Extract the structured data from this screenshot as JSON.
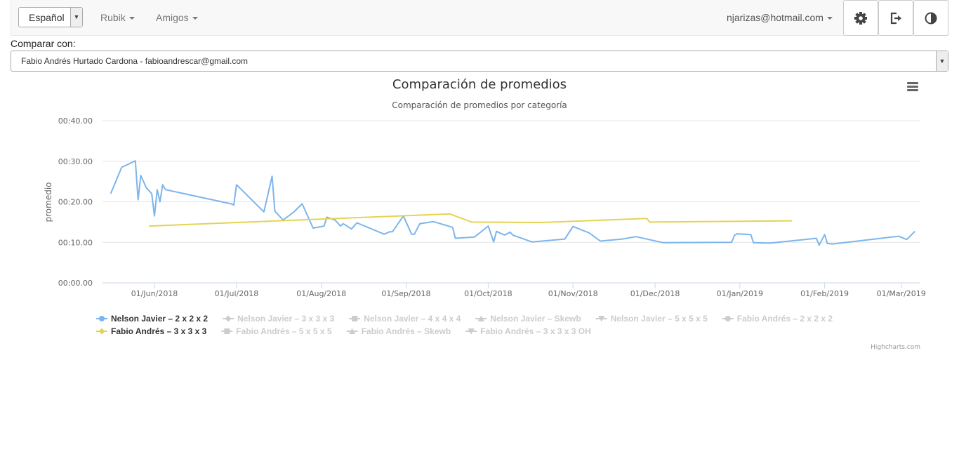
{
  "navbar": {
    "language": "Español",
    "menus": [
      "Rubik",
      "Amigos"
    ],
    "user": "njarizas@hotmail.com",
    "icons": [
      "gear-icon",
      "logout-icon",
      "contrast-icon"
    ]
  },
  "compare": {
    "label": "Comparar con:",
    "selected": "Fabio Andrés Hurtado Cardona - fabioandrescar@gmail.com"
  },
  "chart_data": {
    "type": "line",
    "title": "Comparación de promedios",
    "subtitle": "Comparación de promedios por categoría",
    "ylabel": "promedio",
    "xlabel": "",
    "ylim": [
      0,
      40
    ],
    "yticks": [
      "00:00.00",
      "00:10.00",
      "00:20.00",
      "00:30.00",
      "00:40.00"
    ],
    "xlim": [
      "2018-05-13",
      "2019-03-08"
    ],
    "xticks": [
      {
        "date": "2018-06-01",
        "label": "01/Jun/2018"
      },
      {
        "date": "2018-07-01",
        "label": "01/Jul/2018"
      },
      {
        "date": "2018-08-01",
        "label": "01/Aug/2018"
      },
      {
        "date": "2018-09-01",
        "label": "01/Sep/2018"
      },
      {
        "date": "2018-10-01",
        "label": "01/Oct/2018"
      },
      {
        "date": "2018-11-01",
        "label": "01/Nov/2018"
      },
      {
        "date": "2018-12-01",
        "label": "01/Dec/2018"
      },
      {
        "date": "2019-01-01",
        "label": "01/Jan/2019"
      },
      {
        "date": "2019-02-01",
        "label": "01/Feb/2019"
      },
      {
        "date": "2019-03-01",
        "label": "01/Mar/2019"
      }
    ],
    "grid": true,
    "legend_position": "bottom",
    "legend": [
      {
        "name": "Nelson Javier – 2 x 2 x 2",
        "active": true,
        "color": "#7cb5ec",
        "marker": "circle"
      },
      {
        "name": "Nelson Javier – 3 x 3 x 3",
        "active": false,
        "color": "#cccccc",
        "marker": "diamond"
      },
      {
        "name": "Nelson Javier – 4 x 4 x 4",
        "active": false,
        "color": "#cccccc",
        "marker": "square"
      },
      {
        "name": "Nelson Javier – Skewb",
        "active": false,
        "color": "#cccccc",
        "marker": "triangle"
      },
      {
        "name": "Nelson Javier – 5 x 5 x 5",
        "active": false,
        "color": "#cccccc",
        "marker": "triangle-down"
      },
      {
        "name": "Fabio Andrés – 2 x 2 x 2",
        "active": false,
        "color": "#cccccc",
        "marker": "circle"
      },
      {
        "name": "Fabio Andrés – 3 x 3 x 3",
        "active": true,
        "color": "#e4d354",
        "marker": "diamond"
      },
      {
        "name": "Fabio Andrés – 5 x 5 x 5",
        "active": false,
        "color": "#cccccc",
        "marker": "square"
      },
      {
        "name": "Fabio Andrés – Skewb",
        "active": false,
        "color": "#cccccc",
        "marker": "triangle"
      },
      {
        "name": "Fabio Andrés – 3 x 3 x 3 OH",
        "active": false,
        "color": "#cccccc",
        "marker": "triangle-down"
      }
    ],
    "series": [
      {
        "name": "Nelson Javier – 2 x 2 x 2",
        "color": "#7cb5ec",
        "points": [
          [
            "2018-05-16",
            22.0
          ],
          [
            "2018-05-20",
            28.5
          ],
          [
            "2018-05-25",
            30.1
          ],
          [
            "2018-05-26",
            20.5
          ],
          [
            "2018-05-27",
            26.5
          ],
          [
            "2018-05-29",
            23.5
          ],
          [
            "2018-05-31",
            22.0
          ],
          [
            "2018-06-01",
            16.5
          ],
          [
            "2018-06-02",
            23.0
          ],
          [
            "2018-06-03",
            20.0
          ],
          [
            "2018-06-04",
            24.2
          ],
          [
            "2018-06-05",
            23.0
          ],
          [
            "2018-06-29",
            19.5
          ],
          [
            "2018-06-30",
            19.2
          ],
          [
            "2018-07-01",
            24.2
          ],
          [
            "2018-07-11",
            17.5
          ],
          [
            "2018-07-14",
            26.3
          ],
          [
            "2018-07-15",
            17.7
          ],
          [
            "2018-07-18",
            15.5
          ],
          [
            "2018-07-22",
            17.5
          ],
          [
            "2018-07-25",
            19.5
          ],
          [
            "2018-07-29",
            13.5
          ],
          [
            "2018-08-02",
            14.0
          ],
          [
            "2018-08-03",
            16.2
          ],
          [
            "2018-08-06",
            15.5
          ],
          [
            "2018-08-08",
            14.0
          ],
          [
            "2018-08-09",
            14.6
          ],
          [
            "2018-08-12",
            13.3
          ],
          [
            "2018-08-14",
            14.8
          ],
          [
            "2018-08-24",
            12.0
          ],
          [
            "2018-08-26",
            12.6
          ],
          [
            "2018-08-27",
            12.6
          ],
          [
            "2018-08-31",
            16.5
          ],
          [
            "2018-09-03",
            12.0
          ],
          [
            "2018-09-04",
            12.0
          ],
          [
            "2018-09-06",
            14.6
          ],
          [
            "2018-09-11",
            15.1
          ],
          [
            "2018-09-18",
            13.7
          ],
          [
            "2018-09-19",
            11.0
          ],
          [
            "2018-09-26",
            11.3
          ],
          [
            "2018-10-01",
            14.0
          ],
          [
            "2018-10-03",
            10.1
          ],
          [
            "2018-10-04",
            12.7
          ],
          [
            "2018-10-07",
            11.8
          ],
          [
            "2018-10-09",
            12.5
          ],
          [
            "2018-10-10",
            11.8
          ],
          [
            "2018-10-17",
            10.1
          ],
          [
            "2018-10-29",
            10.8
          ],
          [
            "2018-11-01",
            13.9
          ],
          [
            "2018-11-07",
            12.3
          ],
          [
            "2018-11-11",
            10.3
          ],
          [
            "2018-11-19",
            10.8
          ],
          [
            "2018-11-24",
            11.4
          ],
          [
            "2018-12-04",
            9.9
          ],
          [
            "2018-12-29",
            10.0
          ],
          [
            "2018-12-30",
            11.7
          ],
          [
            "2018-12-31",
            12.1
          ],
          [
            "2019-01-05",
            11.9
          ],
          [
            "2019-01-06",
            9.9
          ],
          [
            "2019-01-12",
            9.8
          ],
          [
            "2019-01-29",
            11.0
          ],
          [
            "2019-01-30",
            9.3
          ],
          [
            "2019-02-01",
            11.9
          ],
          [
            "2019-02-02",
            9.7
          ],
          [
            "2019-02-04",
            9.6
          ],
          [
            "2019-02-28",
            11.5
          ],
          [
            "2019-03-03",
            10.7
          ],
          [
            "2019-03-06",
            12.7
          ]
        ]
      },
      {
        "name": "Fabio Andrés – 3 x 3 x 3",
        "color": "#e4d354",
        "points": [
          [
            "2018-05-30",
            14.0
          ],
          [
            "2018-09-17",
            17.0
          ],
          [
            "2018-09-25",
            15.0
          ],
          [
            "2018-10-21",
            14.9
          ],
          [
            "2018-11-28",
            15.9
          ],
          [
            "2018-11-29",
            15.0
          ],
          [
            "2019-01-20",
            15.3
          ]
        ]
      }
    ],
    "credits": "Highcharts.com",
    "menu_icon": "hamburger-icon"
  }
}
